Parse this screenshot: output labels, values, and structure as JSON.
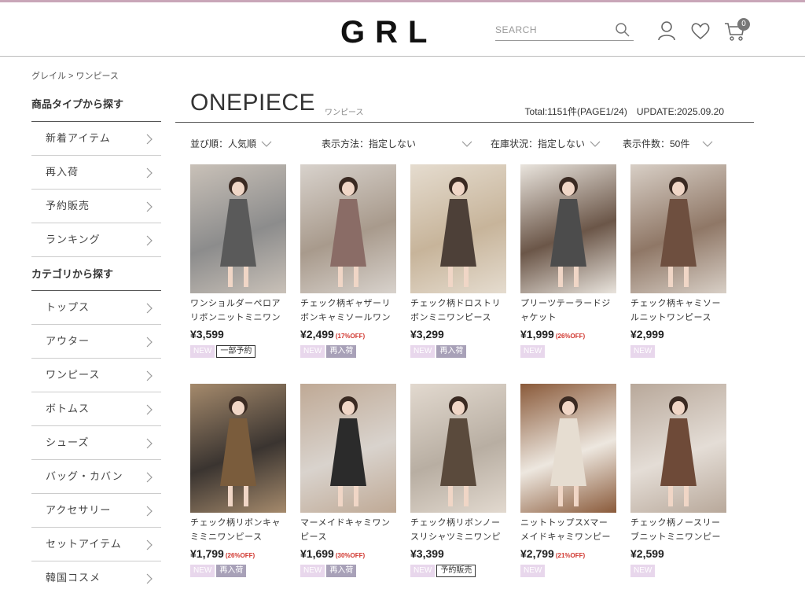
{
  "header": {
    "logo": "GRL",
    "search_placeholder": "SEARCH",
    "cart_count": "0"
  },
  "breadcrumb": [
    "グレイル",
    "> ワンピース"
  ],
  "sidebar": {
    "section1_title": "商品タイプから探す",
    "section1_items": [
      "新着アイテム",
      "再入荷",
      "予約販売",
      "ランキング"
    ],
    "section2_title": "カテゴリから探す",
    "section2_items": [
      "トップス",
      "アウター",
      "ワンピース",
      "ボトムス",
      "シューズ",
      "バッグ・カバン",
      "アクセサリー",
      "セットアイテム",
      "韓国コスメ"
    ]
  },
  "main": {
    "title": "ONEPIECE",
    "subtitle": "ワンピース",
    "total": "Total:1151件(PAGE1/24)　UPDATE:2025.09.20"
  },
  "filters": [
    {
      "label": "並び順：人気順"
    },
    {
      "label": "表示方法：指定しない"
    },
    {
      "label": "在庫状況：指定しない"
    },
    {
      "label": "表示件数：50件"
    }
  ],
  "products": [
    {
      "name": "ワンショルダーペロアリボンニットミニワンピ...",
      "price": "¥3,599",
      "off": "",
      "tags": [
        {
          "t": "NEW",
          "k": "new"
        },
        {
          "t": "一部予約",
          "k": "out"
        }
      ],
      "colors": [
        "#8c8c8c",
        "#5a5a5a",
        "#c9c1b8"
      ]
    },
    {
      "name": "チェック柄ギャザーリボンキャミソールワンピ...",
      "price": "¥2,499",
      "off": "(17%OFF)",
      "tags": [
        {
          "t": "NEW",
          "k": "new"
        },
        {
          "t": "再入荷",
          "k": "re"
        }
      ],
      "colors": [
        "#a89a8c",
        "#8a6c66",
        "#d8d2cc"
      ]
    },
    {
      "name": "チェック柄ドロストリボンミニワンピース",
      "price": "¥3,299",
      "off": "",
      "tags": [
        {
          "t": "NEW",
          "k": "new"
        },
        {
          "t": "再入荷",
          "k": "re"
        }
      ],
      "colors": [
        "#c7b49a",
        "#4d4038",
        "#e5dccf"
      ]
    },
    {
      "name": "プリーツテーラードジャケット",
      "price": "¥1,999",
      "off": "(26%OFF)",
      "tags": [
        {
          "t": "NEW",
          "k": "new"
        }
      ],
      "colors": [
        "#6b5648",
        "#4c4c4c",
        "#e9e4dd"
      ]
    },
    {
      "name": "チェック柄キャミソールニットワンピース",
      "price": "¥2,999",
      "off": "",
      "tags": [
        {
          "t": "NEW",
          "k": "new"
        }
      ],
      "colors": [
        "#8f7766",
        "#6e4f3f",
        "#d8cfc6"
      ]
    },
    {
      "name": "チェック柄リボンキャミミニワンピース",
      "price": "¥1,799",
      "off": "(26%OFF)",
      "tags": [
        {
          "t": "NEW",
          "k": "new"
        },
        {
          "t": "再入荷",
          "k": "re"
        }
      ],
      "colors": [
        "#3a3430",
        "#7a5c3c",
        "#a58a6c"
      ]
    },
    {
      "name": "マーメイドキャミワンピース",
      "price": "¥1,699",
      "off": "(30%OFF)",
      "tags": [
        {
          "t": "NEW",
          "k": "new"
        },
        {
          "t": "再入荷",
          "k": "re"
        }
      ],
      "colors": [
        "#d9d3cd",
        "#2b2b2b",
        "#bfa995"
      ]
    },
    {
      "name": "チェック柄リボンノースリシャツミニワンピース",
      "price": "¥3,399",
      "off": "",
      "tags": [
        {
          "t": "NEW",
          "k": "new"
        },
        {
          "t": "予約販売",
          "k": "out"
        }
      ],
      "colors": [
        "#b8aea2",
        "#5a4a3c",
        "#e2d9cf"
      ]
    },
    {
      "name": "ニットトップスXマーメイドキャミワンピース...",
      "price": "¥2,799",
      "off": "(21%OFF)",
      "tags": [
        {
          "t": "NEW",
          "k": "new"
        }
      ],
      "colors": [
        "#ede7df",
        "#e6ddd1",
        "#8a5a3a"
      ]
    },
    {
      "name": "チェック柄ノースリーブニットミニワンピース",
      "price": "¥2,599",
      "off": "",
      "tags": [
        {
          "t": "NEW",
          "k": "new"
        }
      ],
      "colors": [
        "#e4ddd6",
        "#6e4a38",
        "#b8a89a"
      ]
    }
  ]
}
